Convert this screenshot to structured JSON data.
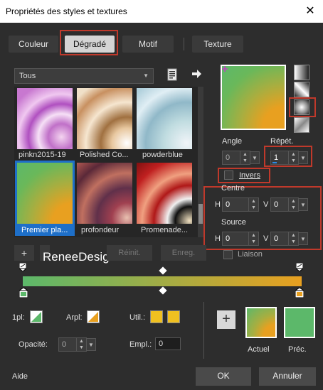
{
  "window": {
    "title": "Propriétés des styles et textures",
    "close": "✕"
  },
  "tabs": [
    {
      "label": "Couleur"
    },
    {
      "label": "Dégradé"
    },
    {
      "label": "Motif"
    },
    {
      "label": "Texture"
    }
  ],
  "category": {
    "selected": "Tous"
  },
  "thumbnails": [
    {
      "label": "pinkn2015-19"
    },
    {
      "label": "Polished Co..."
    },
    {
      "label": "powderblue"
    },
    {
      "label": "Premier pla..."
    },
    {
      "label": "profondeur"
    },
    {
      "label": "Promenade..."
    }
  ],
  "params": {
    "angle_label": "Angle",
    "angle_value": "0",
    "repet_label": "Répét.",
    "repet_value": "1",
    "invers_label": "Invers",
    "centre_label": "Centre",
    "source_label": "Source",
    "h_label": "H",
    "v_label": "V",
    "centre_h": "0",
    "centre_v": "0",
    "source_h": "0",
    "source_v": "0",
    "liaison_label": "Liaison"
  },
  "editor": {
    "add": "+",
    "watermark": "ReneeDesigns",
    "reinit": "Réinit.",
    "enreg": "Enreg."
  },
  "bottom": {
    "first_label": "1pl:",
    "arpl_label": "Arpl:",
    "util_label": "Util.:",
    "opacite_label": "Opacité:",
    "opacite_value": "0",
    "empl_label": "Empl.:",
    "empl_value": "0",
    "plus": "+",
    "actuel_label": "Actuel",
    "prec_label": "Préc."
  },
  "footer": {
    "aide": "Aide",
    "ok": "OK",
    "annuler": "Annuler"
  },
  "colors": {
    "green": "#5cb86a",
    "orange": "#e8a020",
    "gold": "#f0c020",
    "highlight": "#c0392b",
    "selection": "#1e6fc8"
  }
}
